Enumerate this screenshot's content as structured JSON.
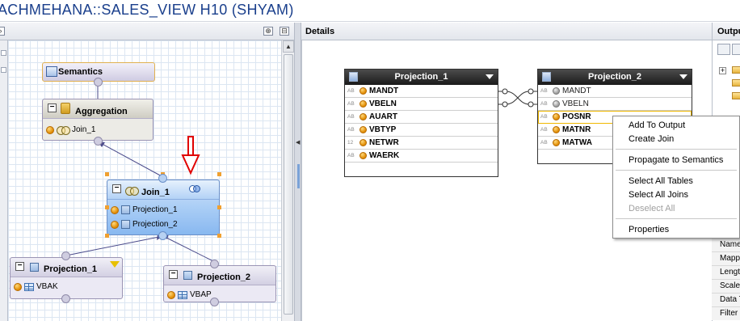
{
  "title": "ACHMEHANA::SALES_VIEW H10 (SHYAM)",
  "panes": {
    "details_title": "Details",
    "output_title": "Output"
  },
  "scenario": {
    "semantics": {
      "label": "Semantics"
    },
    "aggregation": {
      "label": "Aggregation",
      "input": "Join_1"
    },
    "join": {
      "label": "Join_1",
      "inputs": [
        "Projection_1",
        "Projection_2"
      ]
    },
    "projection_1": {
      "label": "Projection_1",
      "source": "VBAK"
    },
    "projection_2": {
      "label": "Projection_2",
      "source": "VBAP"
    },
    "highlight_color": "#e00000"
  },
  "details": {
    "left_table": {
      "title": "Projection_1",
      "columns": [
        {
          "type": "AB",
          "name": "MANDT",
          "state": "active"
        },
        {
          "type": "AB",
          "name": "VBELN",
          "state": "active"
        },
        {
          "type": "AB",
          "name": "AUART",
          "state": "active"
        },
        {
          "type": "AB",
          "name": "VBTYP",
          "state": "active"
        },
        {
          "type": "12",
          "name": "NETWR",
          "state": "active"
        },
        {
          "type": "AB",
          "name": "WAERK",
          "state": "active"
        }
      ]
    },
    "right_table": {
      "title": "Projection_2",
      "columns": [
        {
          "type": "AB",
          "name": "MANDT",
          "state": "inactive"
        },
        {
          "type": "AB",
          "name": "VBELN",
          "state": "inactive"
        },
        {
          "type": "AB",
          "name": "POSNR",
          "state": "selected"
        },
        {
          "type": "AB",
          "name": "MATNR",
          "state": "active"
        },
        {
          "type": "AB",
          "name": "MATWA",
          "state": "active"
        }
      ]
    }
  },
  "context_menu": {
    "items": [
      {
        "label": "Add To Output",
        "enabled": true
      },
      {
        "label": "Create Join",
        "enabled": true
      },
      {
        "label": "Propagate to Semantics",
        "enabled": true
      },
      {
        "label": "Select All Tables",
        "enabled": true
      },
      {
        "label": "Select All Joins",
        "enabled": true
      },
      {
        "label": "Deselect All",
        "enabled": false
      },
      {
        "label": "Properties",
        "enabled": true
      }
    ]
  },
  "properties": {
    "rows": [
      "Name",
      "Mapping",
      "Length",
      "Scale",
      "Data Type",
      "Filter"
    ]
  }
}
